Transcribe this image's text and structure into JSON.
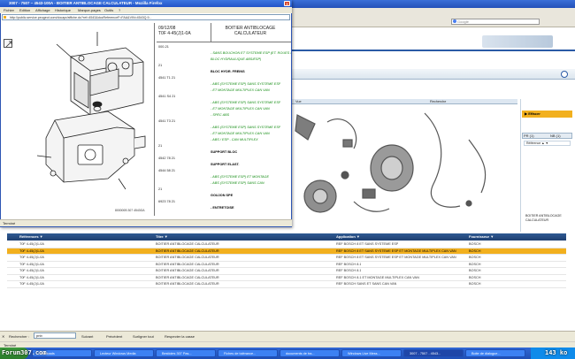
{
  "popup": {
    "title": "3007 - 7507 ~ 4543-100A - BOITIER ANTIBLOCAGE CALCULATEUR - Mozilla Firefox",
    "menu": [
      "Fichier",
      "Edition",
      "Affichage",
      "Historique",
      "Marque-pages",
      "Outils",
      "?"
    ],
    "url": "http://public.service.peugeot.com/docapr/affiche.do?ref=4543&docReferenceF=FAA&VIN=4543Q.9...",
    "status": "Terminé",
    "diagram_code": "800000B 307 4543GA",
    "part_header": {
      "date": "09/12/08",
      "ref": "T0F 4-45(J)1-0A",
      "title_line1": "BOITIER ANTIBLOCAGE",
      "title_line2": "CALCULATEUR"
    },
    "parts": [
      {
        "text": "000-21",
        "style": "normal"
      },
      {
        "text": "- SANS BOUCHON ET SYSTEME ESP (ET. ROUES / SPEC",
        "style": "green"
      },
      {
        "text": "BLOC HYDRAULIQUE ABS/ESP)",
        "style": "green"
      },
      {
        "text": "21",
        "style": "normal"
      },
      {
        "text": "BLOC HYDR. FREINS",
        "style": "bold"
      },
      {
        "text": "4541 T1    21",
        "style": "normal"
      },
      {
        "text": "- ABS (SYSTEME ESP) SANS SYSTEME ESP",
        "style": "green"
      },
      {
        "text": "- ET MONTAGE MULTIPLEX CAN VAN",
        "style": "green"
      },
      {
        "text": "4541 S4    21",
        "style": "normal"
      },
      {
        "text": "- ABS (SYSTEME ESP) SANS SYSTEME ESP",
        "style": "green"
      },
      {
        "text": "- ET MONTAGE MULTIPLEX CAN VAN",
        "style": "green"
      },
      {
        "text": "- SPEC ABS",
        "style": "green"
      },
      {
        "text": "4541 T3    21",
        "style": "normal"
      },
      {
        "text": "- ABS (SYSTEME ESP) SANS SYSTEME ESP",
        "style": "green"
      },
      {
        "text": "- ET MONTAGE MULTIPLEX CAN VAN",
        "style": "green"
      },
      {
        "text": "- ABS / ESP - CAN MULTIPLEX",
        "style": "green"
      },
      {
        "text": "21",
        "style": "normal"
      },
      {
        "text": "SUPPORT BLOC",
        "style": "bold"
      },
      {
        "text": "4542 78    21",
        "style": "normal"
      },
      {
        "text": "SUPPORT ELAST.",
        "style": "bold"
      },
      {
        "text": "4544 58    21",
        "style": "normal"
      },
      {
        "text": "- ABS (SYSTEME ESP) ET MONTAGE",
        "style": "green"
      },
      {
        "text": "- ABS (SYSTEME ESP) SANS CAN",
        "style": "green"
      },
      {
        "text": "21",
        "style": "normal"
      },
      {
        "text": "GOUJON SPE",
        "style": "bold"
      },
      {
        "text": "6923 78    21",
        "style": "normal"
      },
      {
        "text": "- ENTRETOISE",
        "style": "bold"
      }
    ]
  },
  "background": {
    "search_placeholder": "Google",
    "effacer_label": "▶ Effacer",
    "tab_a": "PR (1)",
    "tab_b": "NB (1)",
    "ref_cell": "Référence    ▲ ▼",
    "ref_caption": "BOITIER ANTIBLOCAGE CALCULATEUR",
    "parts_col1": "Vue",
    "parts_col2": "Recherche",
    "table": {
      "headers": [
        "Références ▼",
        "Titre ▼",
        "Application ▼",
        "Fournisseur ▼"
      ],
      "rows": [
        [
          "T0F 4-45(J)1-0A",
          "BOITIER ANTIBLOCAGE CALCULATEUR",
          "REF BOSCH 8 ET SANS SYSTEME ESP",
          "BOSCH",
          false
        ],
        [
          "T0F 4-45(J)1-0A",
          "BOITIER ANTIBLOCAGE CALCULATEUR",
          "REF BOSCH 8 ET SANS SYSTEME ESP ET MONTAGE MULTIPLEX CAN VAN",
          "BOSCH",
          true
        ],
        [
          "T0F 4-45(J)1-0A",
          "BOITIER ANTIBLOCAGE CALCULATEUR",
          "REF BOSCH 8 ET SANS SYSTEME ESP ET MONTAGE MULTIPLEX CAN VAN",
          "BOSCH",
          false
        ],
        [
          "T0F 4-45(J)1-0A",
          "BOITIER ANTIBLOCAGE CALCULATEUR",
          "REF BOSCH 8.1",
          "BOSCH",
          false
        ],
        [
          "T0F 4-45(J)1-0A",
          "BOITIER ANTIBLOCAGE CALCULATEUR",
          "REF BOSCH 8.1",
          "BOSCH",
          false
        ],
        [
          "T0F 4-45(J)1-0A",
          "BOITIER ANTIBLOCAGE CALCULATEUR",
          "REF BOSCH 8.1 ET MONTAGE MULTIPLEX CAN VAN",
          "BOSCH",
          false
        ],
        [
          "T0F 4-45(J)1-0A",
          "BOITIER ANTIBLOCAGE CALCULATEUR",
          "REF BOSCH SANS ET SANS CAN VAN",
          "BOSCH",
          false
        ]
      ]
    },
    "findbar": {
      "label": "Rechercher :",
      "value": "pnb",
      "next": "Suivant",
      "prev": "Précédent",
      "highlight": "Surligner tout",
      "case": "Respecter la casse"
    },
    "status": "Terminé",
    "taskbar": {
      "forum_label": "Forum307.com",
      "ko_label": "143 ko",
      "tasks": [
        "Downloads",
        "Lecteur Windows Media",
        "Bestioles 307 Pas...",
        "Fiches de tolérance...",
        "documents de tra...",
        "Windows Live Mess...",
        "3007 - 7507 - 4543...",
        "Boite de dialogue..."
      ]
    }
  },
  "colors": {
    "title_blue": "#2254c8",
    "highlight_orange": "#f2b01e",
    "header_navy": "#1e3f70",
    "parts_green": "#138c13"
  }
}
